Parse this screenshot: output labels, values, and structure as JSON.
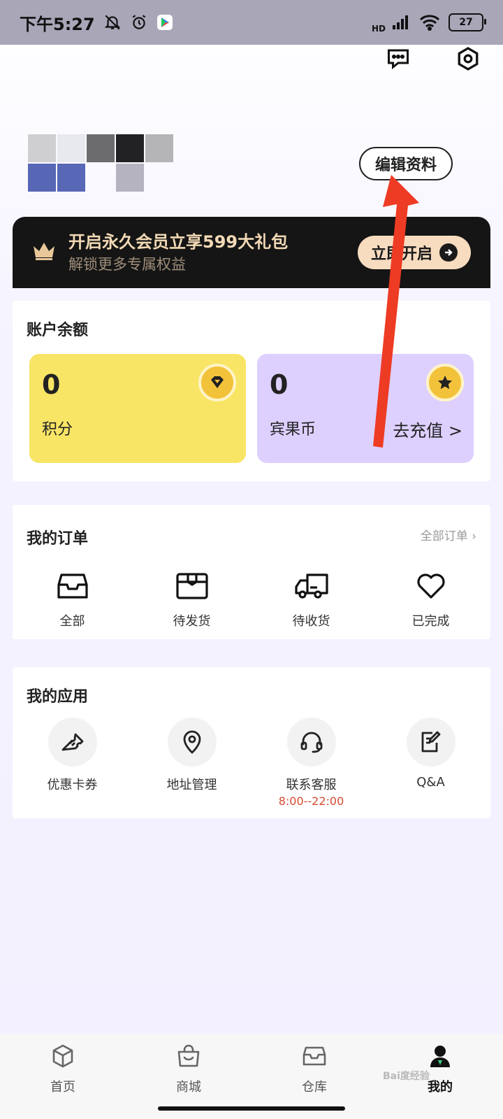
{
  "status_bar": {
    "time": "下午5:27",
    "network_tag": "HD",
    "battery": "27"
  },
  "profile": {
    "edit_label": "编辑资料"
  },
  "vip_banner": {
    "title": "开启永久会员立享599大礼包",
    "subtitle": "解锁更多专属权益",
    "cta_label": "立即开启",
    "title_color": "#f2d9b5",
    "cta_color": "#f8dcc0"
  },
  "balance": {
    "title": "账户余额",
    "points": {
      "value": "0",
      "label": "积分",
      "color": "#f8e565"
    },
    "coins": {
      "value": "0",
      "label": "宾果币",
      "color": "#ddd0ff",
      "action": "去充值 >"
    }
  },
  "orders": {
    "title": "我的订单",
    "all_link": "全部订单 ›",
    "items": [
      {
        "label": "全部",
        "icon": "inbox-icon"
      },
      {
        "label": "待发货",
        "icon": "package-icon"
      },
      {
        "label": "待收货",
        "icon": "truck-icon"
      },
      {
        "label": "已完成",
        "icon": "heart-icon"
      }
    ]
  },
  "apps": {
    "title": "我的应用",
    "items": [
      {
        "label": "优惠卡券",
        "icon": "ticket-icon"
      },
      {
        "label": "地址管理",
        "icon": "location-icon"
      },
      {
        "label": "联系客服",
        "icon": "headset-icon",
        "sub": "8:00--22:00",
        "sub_color": "#d24b31"
      },
      {
        "label": "Q&A",
        "icon": "note-icon"
      }
    ]
  },
  "bottom_nav": {
    "items": [
      {
        "label": "首页",
        "icon": "cube-icon"
      },
      {
        "label": "商城",
        "icon": "shopping-bag-icon"
      },
      {
        "label": "仓库",
        "icon": "box-icon"
      },
      {
        "label": "我的",
        "icon": "user-icon",
        "active": true
      }
    ]
  },
  "watermark": "Bai度经验"
}
